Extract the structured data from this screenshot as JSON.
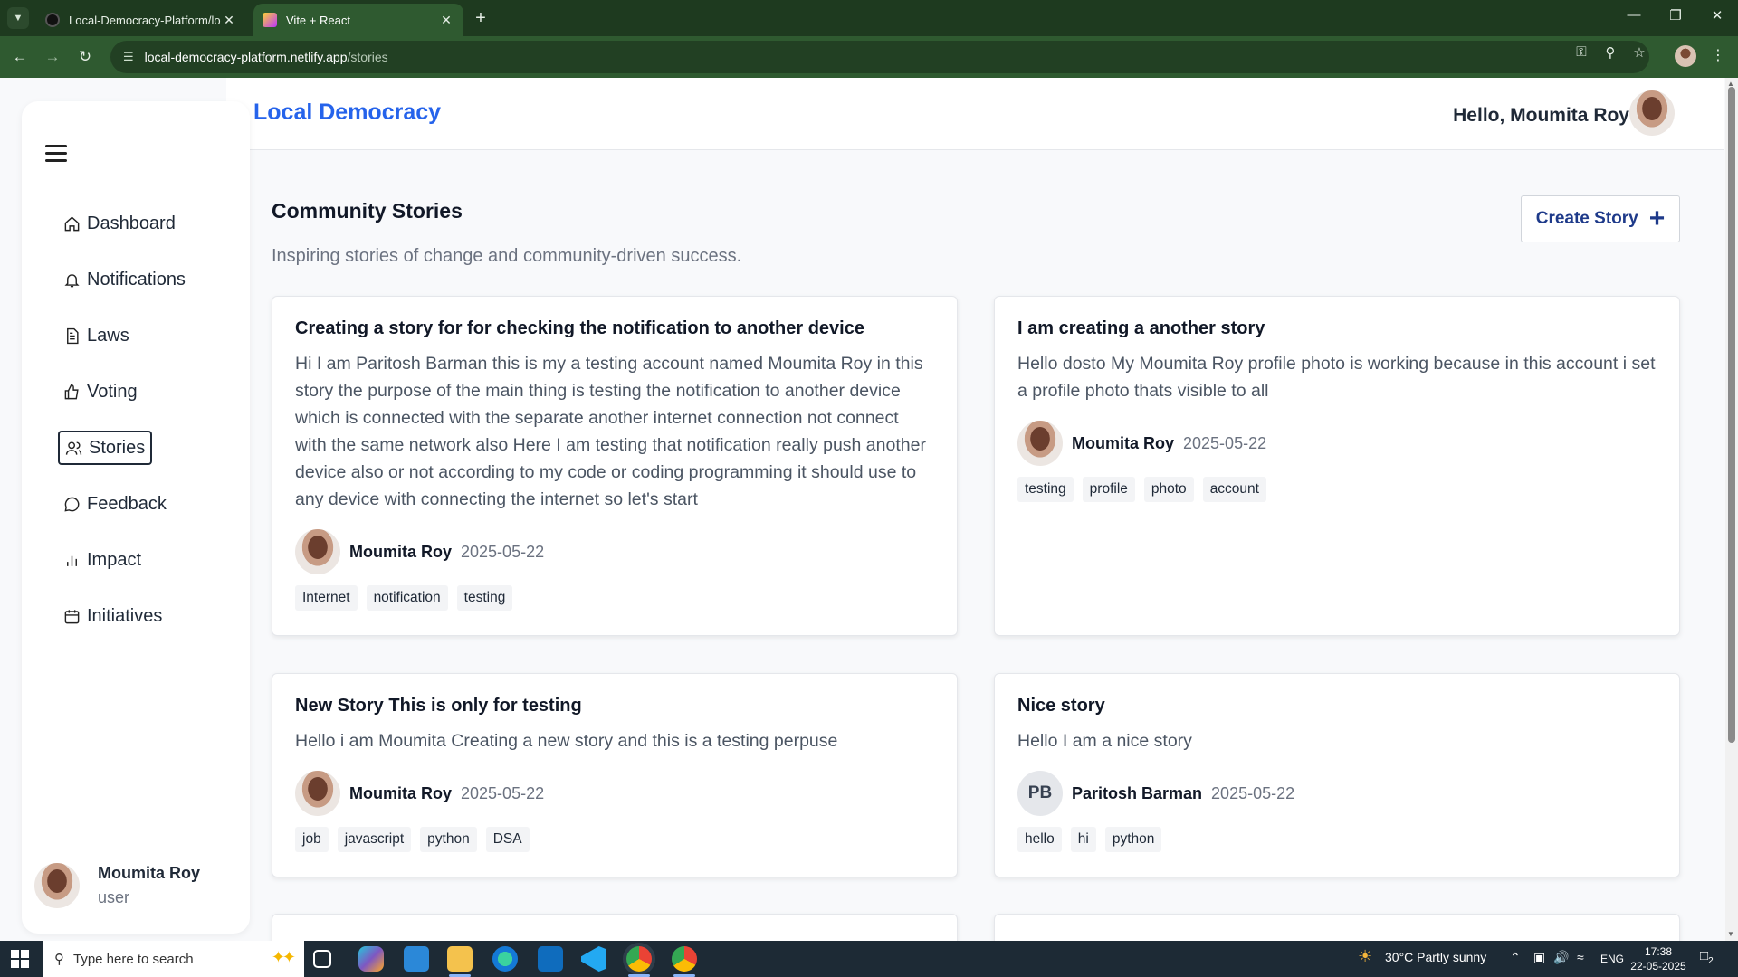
{
  "browser": {
    "tabs": [
      {
        "title": "Local-Democracy-Platform/local",
        "active": false
      },
      {
        "title": "Vite + React",
        "active": true
      }
    ],
    "url_host": "local-democracy-platform.netlify.app",
    "url_path": "/stories"
  },
  "header": {
    "brand": "Local Democracy",
    "greeting": "Hello, Moumita Roy"
  },
  "sidebar": {
    "items": [
      {
        "label": "Dashboard",
        "icon": "home-icon",
        "active": false
      },
      {
        "label": "Notifications",
        "icon": "bell-icon",
        "active": false
      },
      {
        "label": "Laws",
        "icon": "document-icon",
        "active": false
      },
      {
        "label": "Voting",
        "icon": "thumbs-up-icon",
        "active": false
      },
      {
        "label": "Stories",
        "icon": "users-icon",
        "active": true
      },
      {
        "label": "Feedback",
        "icon": "chat-icon",
        "active": false
      },
      {
        "label": "Impact",
        "icon": "bar-chart-icon",
        "active": false
      },
      {
        "label": "Initiatives",
        "icon": "calendar-icon",
        "active": false
      }
    ],
    "user": {
      "name": "Moumita Roy",
      "role": "user"
    }
  },
  "main": {
    "title": "Community Stories",
    "subtitle": "Inspiring stories of change and community-driven success.",
    "create_label": "Create Story",
    "stories": [
      {
        "title": "Creating a story for for checking the notification to another device",
        "body": "Hi I am Paritosh Barman this is my a testing account named Moumita Roy in this story the purpose of the main thing is testing the notification to another device which is connected with the separate another internet connection not connect with the same network also Here I am testing that notification really push another device also or not according to my code or coding programming it should use to any device with connecting the internet so let's start",
        "author": "Moumita Roy",
        "initials": "",
        "date": "2025-05-22",
        "tags": [
          "Internet",
          "notification",
          "testing"
        ]
      },
      {
        "title": "I am creating a another story",
        "body": "Hello dosto My Moumita Roy profile photo is working because in this account i set a profile photo thats visible to all",
        "author": "Moumita Roy",
        "initials": "",
        "date": "2025-05-22",
        "tags": [
          "testing",
          "profile",
          "photo",
          "account"
        ]
      },
      {
        "title": "New Story This is only for testing",
        "body": "Hello i am Moumita Creating a new story and this is a testing perpuse",
        "author": "Moumita Roy",
        "initials": "",
        "date": "2025-05-22",
        "tags": [
          "job",
          "javascript",
          "python",
          "DSA"
        ]
      },
      {
        "title": "Nice story",
        "body": "Hello I am a nice story",
        "author": "Paritosh Barman",
        "initials": "PB",
        "date": "2025-05-22",
        "tags": [
          "hello",
          "hi",
          "python"
        ]
      }
    ]
  },
  "taskbar": {
    "search_placeholder": "Type here to search",
    "weather": "30°C  Partly sunny",
    "lang": "ENG",
    "time": "17:38",
    "date": "22-05-2025",
    "notif_count": "2"
  }
}
